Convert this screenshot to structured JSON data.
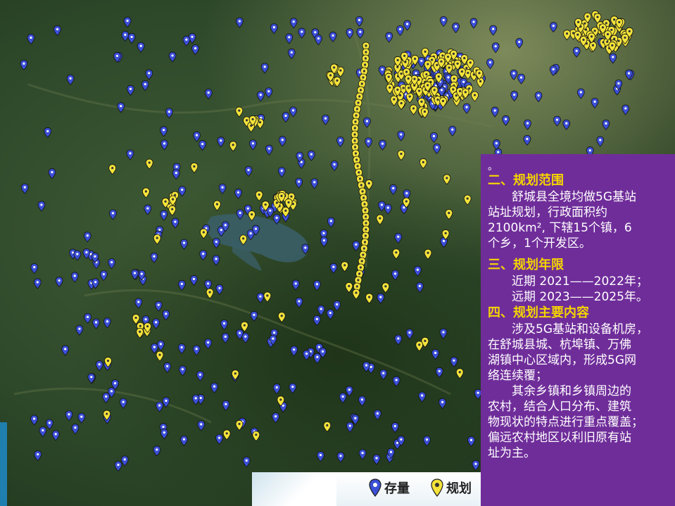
{
  "panel": {
    "dot": "。",
    "sections": [
      {
        "heading": "二、规划范围",
        "paras": [
          [
            "舒城县全境均做5G基站",
            "站址规划，行政面积约",
            "2100km², 下辖15个镇，6",
            "个乡，1个开发区。"
          ]
        ]
      },
      {
        "heading": "三、规划年限",
        "paras": [
          [
            "近期  2021——2022年；"
          ],
          [
            "远期  2023——2025年。"
          ]
        ]
      },
      {
        "heading": "四、规划主要内容",
        "paras": [
          [
            "涉及5G基站和设备机房，",
            "在舒城县城、杭埠镇、万佛",
            "湖镇中心区域内，形成5G网",
            "络连续覆；"
          ],
          [
            "其余乡镇和乡镇周边的",
            "农村，结合人口分布、建筑",
            "物现状的特点进行重点覆盖；",
            "偏远农村地区以利旧原有站",
            "址为主。"
          ]
        ]
      }
    ]
  },
  "legend": {
    "existing_label": "存量",
    "planned_label": "规划"
  },
  "colors": {
    "panel_bg": "#6f2d9a",
    "heading": "#f5d400",
    "existing_pin": "#3b4fd6",
    "planned_pin": "#f3e33a"
  }
}
